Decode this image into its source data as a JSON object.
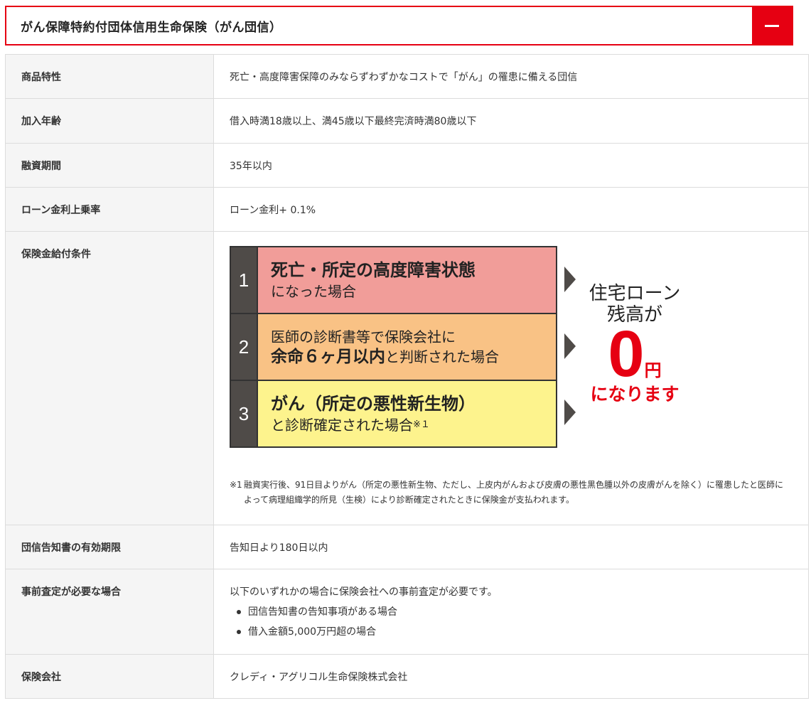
{
  "accordion": {
    "title": "がん保障特約付団体信用生命保険（がん団信）",
    "toggle_symbol": "−"
  },
  "rows": {
    "product": {
      "label": "商品特性",
      "value": "死亡・高度障害保障のみならずわずかなコストで「がん」の罹患に備える団信"
    },
    "age": {
      "label": "加入年齢",
      "value": "借入時満18歳以上、満45歳以下最終完済時満80歳以下"
    },
    "term": {
      "label": "融資期間",
      "value": "35年以内"
    },
    "rate": {
      "label": "ローン金利上乗率",
      "value": "ローン金利+ 0.1%"
    },
    "conditions": {
      "label": "保険金給付条件",
      "items": [
        {
          "num": "1",
          "line1": "死亡・所定の高度障害状態",
          "line2": "になった場合"
        },
        {
          "num": "2",
          "line1": "医師の診断書等で保険会社に",
          "line2_bold": "余命６ヶ月以内",
          "line2_rest": "と判断された場合"
        },
        {
          "num": "3",
          "line1": "がん（所定の悪性新生物）",
          "line2": "と診断確定された場合",
          "note_mark": "※１"
        }
      ],
      "result": {
        "line1": "住宅ローン",
        "line2": "残高が",
        "zero": "0",
        "yen": "円",
        "line3": "になります"
      },
      "footnote_mark": "※1",
      "footnote": "融資実行後、91日目よりがん（所定の悪性新生物、ただし、上皮内がんおよび皮膚の悪性黒色腫以外の皮膚がんを除く）に罹患したと医師によって病理組織学的所見（生検）により診断確定されたときに保険金が支払われます。"
    },
    "validity": {
      "label": "団信告知書の有効期限",
      "value": "告知日より180日以内"
    },
    "prescreen": {
      "label": "事前査定が必要な場合",
      "intro": "以下のいずれかの場合に保険会社への事前査定が必要です。",
      "bullets": [
        "団信告知書の告知事項がある場合",
        "借入金額5,000万円超の場合"
      ]
    },
    "insurer": {
      "label": "保険会社",
      "value": "クレディ・アグリコル生命保険株式会社"
    }
  },
  "colors": {
    "accent": "#e60012",
    "cond1": "#f19d99",
    "cond2": "#f9c285",
    "cond3": "#fdf38d",
    "num_bg": "#4f4b48",
    "label_bg": "#f5f5f5"
  }
}
